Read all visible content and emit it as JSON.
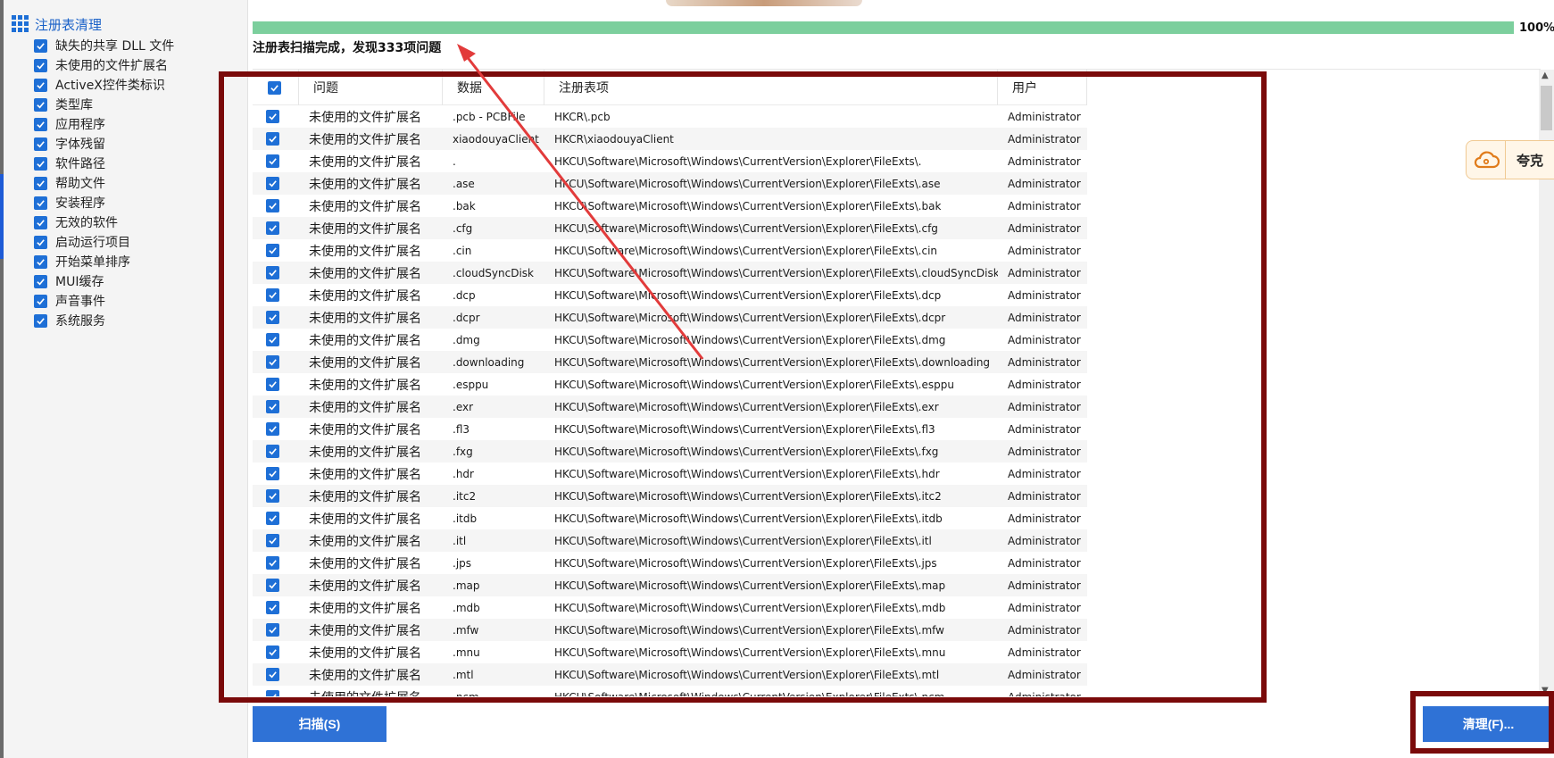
{
  "sidebar": {
    "title": "注册表清理",
    "items": [
      {
        "label": "缺失的共享 DLL 文件",
        "checked": true
      },
      {
        "label": "未使用的文件扩展名",
        "checked": true
      },
      {
        "label": "ActiveX控件类标识",
        "checked": true
      },
      {
        "label": "类型库",
        "checked": true
      },
      {
        "label": "应用程序",
        "checked": true
      },
      {
        "label": "字体残留",
        "checked": true
      },
      {
        "label": "软件路径",
        "checked": true
      },
      {
        "label": "帮助文件",
        "checked": true
      },
      {
        "label": "安装程序",
        "checked": true
      },
      {
        "label": "无效的软件",
        "checked": true
      },
      {
        "label": "启动运行项目",
        "checked": true
      },
      {
        "label": "开始菜单排序",
        "checked": true
      },
      {
        "label": "MUI缓存",
        "checked": true
      },
      {
        "label": "声音事件",
        "checked": true
      },
      {
        "label": "系统服务",
        "checked": true
      }
    ]
  },
  "progress": {
    "percent_label": "100%",
    "value": 1.0,
    "color": "#7ccf9d"
  },
  "scan_status": "注册表扫描完成，发现333项问题",
  "table": {
    "columns": [
      "问题",
      "数据",
      "注册表项",
      "用户"
    ],
    "rows": [
      {
        "issue": "未使用的文件扩展名",
        "data": ".pcb - PCBFile",
        "key": "HKCR\\.pcb",
        "user": "Administrator"
      },
      {
        "issue": "未使用的文件扩展名",
        "data": "xiaodouyaClient",
        "key": "HKCR\\xiaodouyaClient",
        "user": "Administrator"
      },
      {
        "issue": "未使用的文件扩展名",
        "data": ".",
        "key": "HKCU\\Software\\Microsoft\\Windows\\CurrentVersion\\Explorer\\FileExts\\.",
        "user": "Administrator"
      },
      {
        "issue": "未使用的文件扩展名",
        "data": ".ase",
        "key": "HKCU\\Software\\Microsoft\\Windows\\CurrentVersion\\Explorer\\FileExts\\.ase",
        "user": "Administrator"
      },
      {
        "issue": "未使用的文件扩展名",
        "data": ".bak",
        "key": "HKCU\\Software\\Microsoft\\Windows\\CurrentVersion\\Explorer\\FileExts\\.bak",
        "user": "Administrator"
      },
      {
        "issue": "未使用的文件扩展名",
        "data": ".cfg",
        "key": "HKCU\\Software\\Microsoft\\Windows\\CurrentVersion\\Explorer\\FileExts\\.cfg",
        "user": "Administrator"
      },
      {
        "issue": "未使用的文件扩展名",
        "data": ".cin",
        "key": "HKCU\\Software\\Microsoft\\Windows\\CurrentVersion\\Explorer\\FileExts\\.cin",
        "user": "Administrator"
      },
      {
        "issue": "未使用的文件扩展名",
        "data": ".cloudSyncDisk",
        "key": "HKCU\\Software\\Microsoft\\Windows\\CurrentVersion\\Explorer\\FileExts\\.cloudSyncDisk",
        "user": "Administrator"
      },
      {
        "issue": "未使用的文件扩展名",
        "data": ".dcp",
        "key": "HKCU\\Software\\Microsoft\\Windows\\CurrentVersion\\Explorer\\FileExts\\.dcp",
        "user": "Administrator"
      },
      {
        "issue": "未使用的文件扩展名",
        "data": ".dcpr",
        "key": "HKCU\\Software\\Microsoft\\Windows\\CurrentVersion\\Explorer\\FileExts\\.dcpr",
        "user": "Administrator"
      },
      {
        "issue": "未使用的文件扩展名",
        "data": ".dmg",
        "key": "HKCU\\Software\\Microsoft\\Windows\\CurrentVersion\\Explorer\\FileExts\\.dmg",
        "user": "Administrator"
      },
      {
        "issue": "未使用的文件扩展名",
        "data": ".downloading",
        "key": "HKCU\\Software\\Microsoft\\Windows\\CurrentVersion\\Explorer\\FileExts\\.downloading",
        "user": "Administrator"
      },
      {
        "issue": "未使用的文件扩展名",
        "data": ".esppu",
        "key": "HKCU\\Software\\Microsoft\\Windows\\CurrentVersion\\Explorer\\FileExts\\.esppu",
        "user": "Administrator"
      },
      {
        "issue": "未使用的文件扩展名",
        "data": ".exr",
        "key": "HKCU\\Software\\Microsoft\\Windows\\CurrentVersion\\Explorer\\FileExts\\.exr",
        "user": "Administrator"
      },
      {
        "issue": "未使用的文件扩展名",
        "data": ".fl3",
        "key": "HKCU\\Software\\Microsoft\\Windows\\CurrentVersion\\Explorer\\FileExts\\.fl3",
        "user": "Administrator"
      },
      {
        "issue": "未使用的文件扩展名",
        "data": ".fxg",
        "key": "HKCU\\Software\\Microsoft\\Windows\\CurrentVersion\\Explorer\\FileExts\\.fxg",
        "user": "Administrator"
      },
      {
        "issue": "未使用的文件扩展名",
        "data": ".hdr",
        "key": "HKCU\\Software\\Microsoft\\Windows\\CurrentVersion\\Explorer\\FileExts\\.hdr",
        "user": "Administrator"
      },
      {
        "issue": "未使用的文件扩展名",
        "data": ".itc2",
        "key": "HKCU\\Software\\Microsoft\\Windows\\CurrentVersion\\Explorer\\FileExts\\.itc2",
        "user": "Administrator"
      },
      {
        "issue": "未使用的文件扩展名",
        "data": ".itdb",
        "key": "HKCU\\Software\\Microsoft\\Windows\\CurrentVersion\\Explorer\\FileExts\\.itdb",
        "user": "Administrator"
      },
      {
        "issue": "未使用的文件扩展名",
        "data": ".itl",
        "key": "HKCU\\Software\\Microsoft\\Windows\\CurrentVersion\\Explorer\\FileExts\\.itl",
        "user": "Administrator"
      },
      {
        "issue": "未使用的文件扩展名",
        "data": ".jps",
        "key": "HKCU\\Software\\Microsoft\\Windows\\CurrentVersion\\Explorer\\FileExts\\.jps",
        "user": "Administrator"
      },
      {
        "issue": "未使用的文件扩展名",
        "data": ".map",
        "key": "HKCU\\Software\\Microsoft\\Windows\\CurrentVersion\\Explorer\\FileExts\\.map",
        "user": "Administrator"
      },
      {
        "issue": "未使用的文件扩展名",
        "data": ".mdb",
        "key": "HKCU\\Software\\Microsoft\\Windows\\CurrentVersion\\Explorer\\FileExts\\.mdb",
        "user": "Administrator"
      },
      {
        "issue": "未使用的文件扩展名",
        "data": ".mfw",
        "key": "HKCU\\Software\\Microsoft\\Windows\\CurrentVersion\\Explorer\\FileExts\\.mfw",
        "user": "Administrator"
      },
      {
        "issue": "未使用的文件扩展名",
        "data": ".mnu",
        "key": "HKCU\\Software\\Microsoft\\Windows\\CurrentVersion\\Explorer\\FileExts\\.mnu",
        "user": "Administrator"
      },
      {
        "issue": "未使用的文件扩展名",
        "data": ".mtl",
        "key": "HKCU\\Software\\Microsoft\\Windows\\CurrentVersion\\Explorer\\FileExts\\.mtl",
        "user": "Administrator"
      },
      {
        "issue": "未使用的文件扩展名",
        "data": ".ncm",
        "key": "HKCU\\Software\\Microsoft\\Windows\\CurrentVersion\\Explorer\\FileExts\\.ncm",
        "user": "Administrator"
      }
    ]
  },
  "side_badge": {
    "text": "夸克"
  },
  "buttons": {
    "scan": "扫描(S)",
    "clean": "清理(F)..."
  },
  "colors": {
    "accent": "#2f72d6",
    "annotation": "#7a0a0a",
    "arrow": "#e23b3b"
  }
}
